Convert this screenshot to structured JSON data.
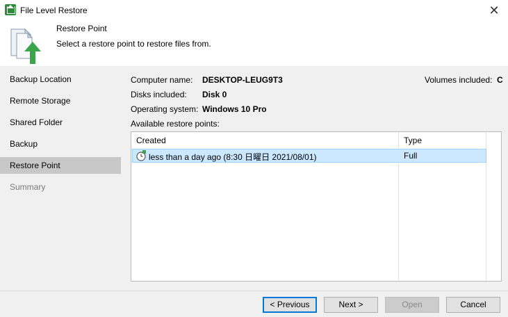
{
  "window": {
    "title": "File Level Restore",
    "close_glyph": "✕"
  },
  "header": {
    "title": "Restore Point",
    "subtitle": "Select a restore point to restore files from."
  },
  "sidebar": {
    "items": [
      {
        "label": "Backup Location"
      },
      {
        "label": "Remote Storage"
      },
      {
        "label": "Shared Folder"
      },
      {
        "label": "Backup"
      },
      {
        "label": "Restore Point"
      },
      {
        "label": "Summary"
      }
    ]
  },
  "info": {
    "computer_name_label": "Computer name:",
    "computer_name": "DESKTOP-LEUG9T3",
    "disks_label": "Disks included:",
    "disks": "Disk 0",
    "os_label": "Operating system:",
    "os": "Windows 10 Pro",
    "volumes_label": "Volumes included:",
    "volumes": "C",
    "available_label": "Available restore points:"
  },
  "table": {
    "columns": [
      "Created",
      "Type"
    ],
    "rows": [
      {
        "created": "less than a day ago (8:30 日曜日 2021/08/01)",
        "type": "Full",
        "icon": "restore-point-clock-icon"
      }
    ]
  },
  "buttons": {
    "previous": "< Previous",
    "next": "Next >",
    "open": "Open",
    "cancel": "Cancel"
  },
  "colors": {
    "accent": "#0078d7",
    "selection": "#cce8ff",
    "arrow_green": "#3aa54a"
  }
}
